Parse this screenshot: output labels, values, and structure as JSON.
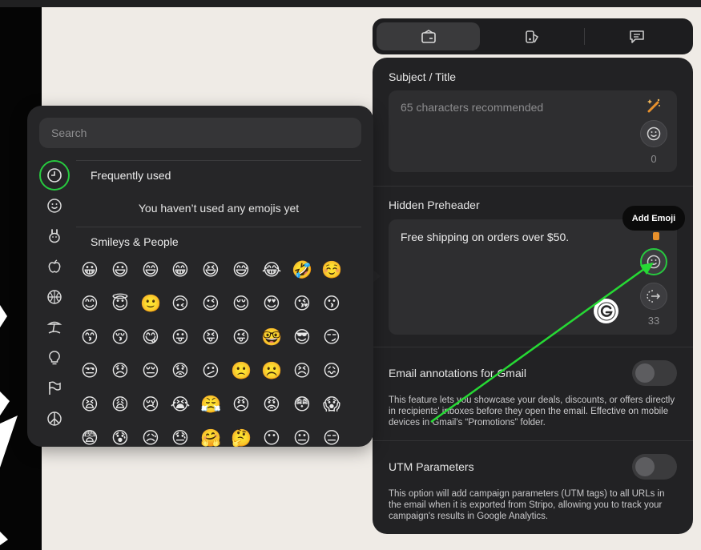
{
  "tabs": [
    {
      "name": "settings",
      "icon": "email-settings-icon",
      "active": true
    },
    {
      "name": "design",
      "icon": "paint-icon",
      "active": false
    },
    {
      "name": "comments",
      "icon": "comment-icon",
      "active": false
    }
  ],
  "subject": {
    "label": "Subject / Title",
    "placeholder": "65 characters recommended",
    "counter": "0"
  },
  "preheader": {
    "label": "Hidden Preheader",
    "value": "Free shipping on orders over $50.",
    "counter": "33"
  },
  "tooltip": "Add Emoji",
  "gmail": {
    "label": "Email annotations for Gmail",
    "enabled": false,
    "description": "This feature lets you showcase your deals, discounts, or offers directly in recipients' inboxes before they open the email. Effective on mobile devices in Gmail's “Promotions” folder."
  },
  "utm": {
    "label": "UTM Parameters",
    "enabled": false,
    "description": "This option will add campaign parameters (UTM tags) to all URLs in the email when it is exported from Stripo, allowing you to track your campaign's results in Google Analytics."
  },
  "emoji_picker": {
    "search_placeholder": "Search",
    "categories": [
      "clock-icon",
      "smiley-icon",
      "animal-icon",
      "food-icon",
      "sports-icon",
      "travel-icon",
      "lightbulb-icon",
      "flag-icon",
      "peace-icon"
    ],
    "frequently_used_label": "Frequently used",
    "empty_message": "You haven’t used any emojis yet",
    "smileys_label": "Smileys & People",
    "emojis": [
      [
        "😀",
        "😃",
        "😄",
        "😁",
        "😆",
        "😅",
        "😂",
        "🤣",
        "☺️"
      ],
      [
        "😊",
        "😇",
        "🙂",
        "🙃",
        "😉",
        "😌",
        "😍",
        "😘",
        "😗"
      ],
      [
        "😙",
        "😚",
        "😋",
        "😛",
        "😝",
        "😜",
        "🤓",
        "😎",
        "😏"
      ],
      [
        "😒",
        "😞",
        "😔",
        "😟",
        "😕",
        "🙁",
        "☹️",
        "😣",
        "😖"
      ],
      [
        "😫",
        "😩",
        "😢",
        "😭",
        "😤",
        "😠",
        "😡",
        "😳",
        "😱"
      ],
      [
        "😨",
        "😰",
        "😥",
        "😓",
        "🤗",
        "🤔",
        "😶",
        "😐",
        "😑"
      ]
    ]
  }
}
